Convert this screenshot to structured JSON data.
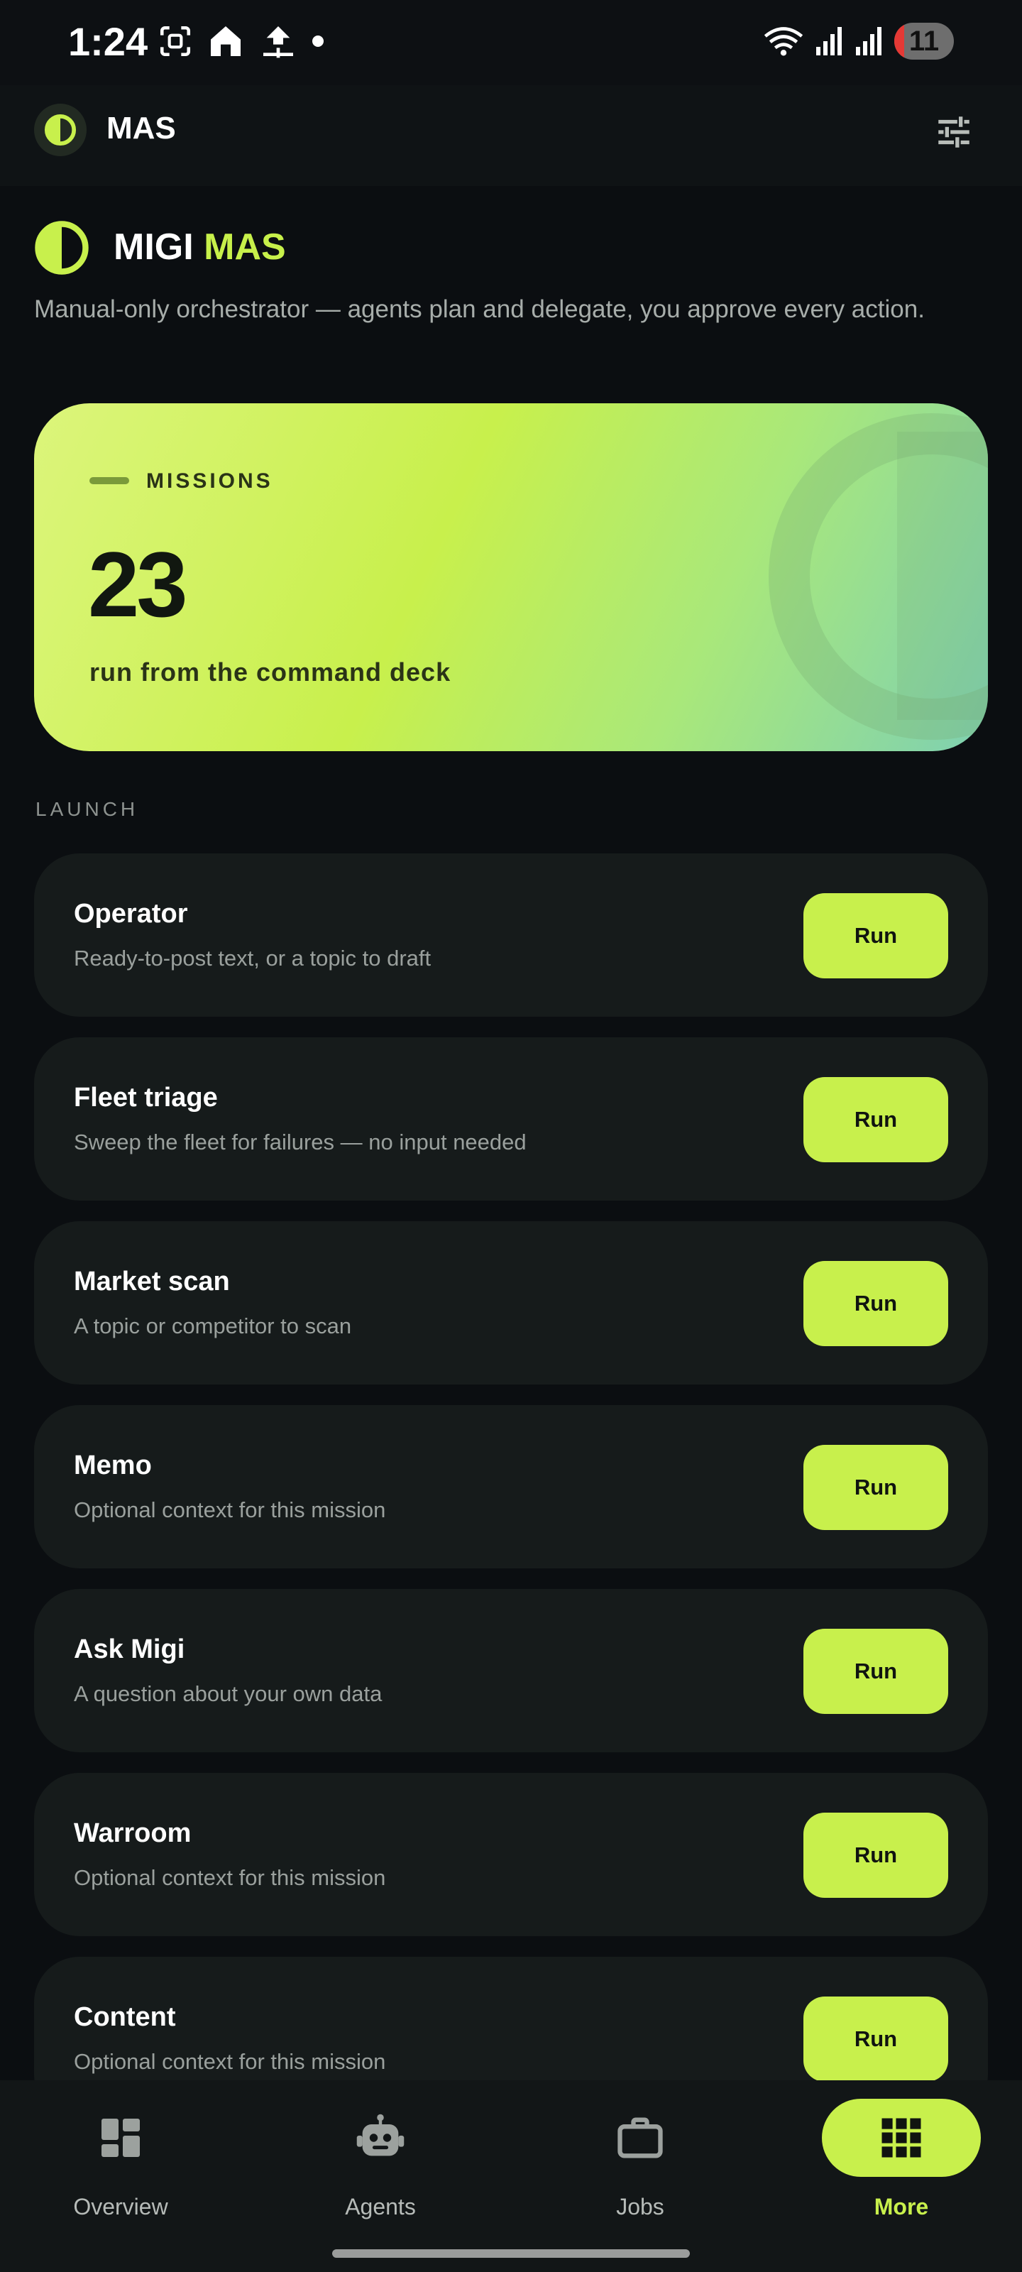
{
  "status_bar": {
    "time": "1:24",
    "battery": "11",
    "icons": [
      "screenshot-icon",
      "home-app-icon",
      "upload-icon",
      "dot-icon",
      "wifi-icon",
      "signal-icon",
      "signal-roaming-icon"
    ]
  },
  "app_bar": {
    "title": "MAS",
    "filter_icon": "tune-icon"
  },
  "header": {
    "brand_prefix": "MIGI",
    "brand_accent": "MAS",
    "tagline": "Manual-only orchestrator — agents plan and delegate, you approve every action."
  },
  "hero": {
    "label": "MISSIONS",
    "count": "23",
    "subtitle": "run from the command deck"
  },
  "section_label": "LAUNCH",
  "missions": [
    {
      "title": "Operator",
      "description": "Ready-to-post text, or a topic to draft",
      "button": "Run"
    },
    {
      "title": "Fleet triage",
      "description": "Sweep the fleet for failures — no input needed",
      "button": "Run"
    },
    {
      "title": "Market scan",
      "description": "A topic or competitor to scan",
      "button": "Run"
    },
    {
      "title": "Memo",
      "description": "Optional context for this mission",
      "button": "Run"
    },
    {
      "title": "Ask Migi",
      "description": "A question about your own data",
      "button": "Run"
    },
    {
      "title": "Warroom",
      "description": "Optional context for this mission",
      "button": "Run"
    },
    {
      "title": "Content",
      "description": "Optional context for this mission",
      "button": "Run"
    }
  ],
  "bottom_nav": [
    {
      "label": "Overview",
      "icon": "dashboard-icon",
      "active": false
    },
    {
      "label": "Agents",
      "icon": "robot-icon",
      "active": false
    },
    {
      "label": "Jobs",
      "icon": "briefcase-icon",
      "active": false
    },
    {
      "label": "More",
      "icon": "apps-grid-icon",
      "active": true
    }
  ],
  "colors": {
    "accent": "#c8f04c",
    "background": "#0b0e11",
    "card": "#161b1b"
  }
}
